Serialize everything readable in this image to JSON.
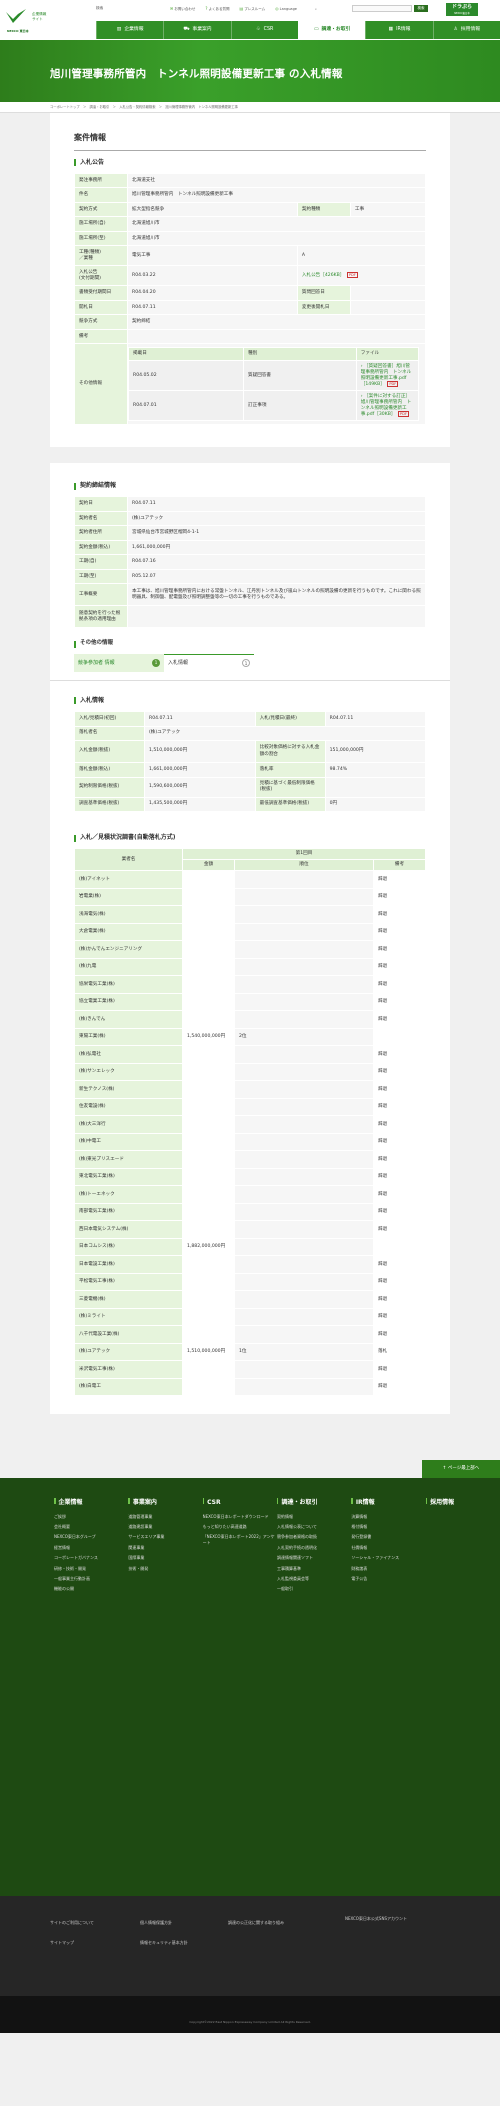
{
  "header": {
    "logo_text": "NEXCO 東日本",
    "corp_name": [
      "企業情報",
      "サイト"
    ],
    "search_label": "検索",
    "util": [
      "お問い合わせ",
      "よくある質問",
      "プレスルーム",
      "Language"
    ],
    "search_btn": "検索",
    "doraburu": "ドラぷら",
    "doraburu_sub": "NEXCO東日本"
  },
  "nav": [
    "企業情報",
    "事業案内",
    "CSR",
    "調達・お取引",
    "IR情報",
    "採用情報"
  ],
  "page": {
    "title": "旭川管理事務所管内　トンネル照明設備更新工事 の入札情報",
    "breadcrumb": "コーポレートトップ　＞　調達・お取引　＞　入札公告・契約情報検索　＞　旭川管理事務所管内　トンネル照明設備更新工事"
  },
  "case": {
    "title": "案件情報",
    "sub": "入札公告",
    "rows": [
      {
        "k": "発注事務所",
        "v": "北海道支社"
      },
      {
        "k": "件名",
        "v": "旭川管理事務所管内　トンネル照明設備更新工事"
      },
      {
        "k": "契約方式",
        "v": "拡大型指名競争",
        "k2": "契約種類",
        "v2": "工事"
      },
      {
        "k": "施工場所(自)",
        "v": "北海道旭川市"
      },
      {
        "k": "施工場所(至)",
        "v": "北海道旭川市"
      },
      {
        "k": "工種(種類)\n／業種",
        "v": "電気工事",
        "v2": "A"
      },
      {
        "k": "入札公告\n(文付期間)",
        "v": "R04.03.22",
        "v2": "入札公告［426KB］"
      },
      {
        "k": "書類受付期間日",
        "v": "R04.04.20",
        "k2": "質問回答日",
        "v2": ""
      },
      {
        "k": "開札日",
        "v": "R04.07.11",
        "k2": "変更後開札日",
        "v2": ""
      },
      {
        "k": "競争方式",
        "v": "契約締結"
      },
      {
        "k": "備考",
        "v": ""
      }
    ],
    "other_label": "その他情報",
    "other_head": [
      "掲載日",
      "種別",
      "ファイル"
    ],
    "other_rows": [
      {
        "date": "R04.05.02",
        "type": "質疑回答書",
        "file": "［質疑回答書］旭川管理事務所管内　トンネル照明設備更新工事.pdf［149KB］"
      },
      {
        "date": "R04.07.01",
        "type": "訂正事項",
        "file": "［案件に対する訂正］旭川管理事務所管内　トンネル照明設備更新工事.pdf［30KB］"
      }
    ]
  },
  "contract": {
    "sub": "契約締結情報",
    "rows": [
      {
        "k": "契約日",
        "v": "R04.07.11"
      },
      {
        "k": "契約者名",
        "v": "(株)ユアテック"
      },
      {
        "k": "契約者住所",
        "v": "宮城県仙台市宮城野区榴岡4-1-1"
      },
      {
        "k": "契約金額(税込)",
        "v": "1,661,000,000円"
      },
      {
        "k": "工期(自)",
        "v": "R04.07.16"
      },
      {
        "k": "工期(至)",
        "v": "R05.12.07"
      },
      {
        "k": "工事概要",
        "v": "本工事は、旭川管理事務所管内における常盤トンネル、江丹別トンネル及び嵐山トンネルの照明設備の更新を行うものです。これに関わる照明器具、制御盤、配電盤及び照明調整盤等の一切の工事を行うものである。"
      },
      {
        "k": "随意契約を行った根拠条項の適用理由",
        "v": ""
      }
    ]
  },
  "other_info": {
    "title": "その他の情報",
    "tabs": [
      {
        "label": "競争参加者 情報",
        "count": "1"
      },
      {
        "label": "入札情報",
        "count": "1"
      }
    ]
  },
  "bid": {
    "sub": "入札情報",
    "rows": [
      {
        "k": "入札/見積日(初回)",
        "v": "R04.07.11",
        "k2": "入札/見積日(最終)",
        "v2": "R04.07.11"
      },
      {
        "k": "落札者名",
        "v": "(株)ユアテック"
      },
      {
        "k": "入札金額(税抜)",
        "v": "1,510,000,000円",
        "k2": "比較対象価格に対する入札金額の割合",
        "v2": "151,000,000円"
      },
      {
        "k": "落札金額(税込)",
        "v": "1,661,000,000円",
        "k2": "落札率",
        "v2": "98.74%"
      },
      {
        "k": "契約制限価格(税抜)",
        "v": "1,590,600,000円",
        "k2": "見積に基づく最低制限価格(税抜)",
        "v2": ""
      },
      {
        "k": "調査基準価格(税抜)",
        "v": "1,435,500,000円",
        "k2": "最低調査基準価格(税抜)",
        "v2": "0円"
      }
    ]
  },
  "status": {
    "sub": "入札／見積状況調書(自動落札方式)",
    "head": [
      "業者名",
      "第1回目",
      "金額",
      "順位",
      "備考"
    ],
    "rows": [
      [
        "(株)アイネット",
        "",
        "",
        "辞退"
      ],
      [
        "岩電業(株)",
        "",
        "",
        "辞退"
      ],
      [
        "浅海電気(株)",
        "",
        "",
        "辞退"
      ],
      [
        "大倉電業(株)",
        "",
        "",
        "辞退"
      ],
      [
        "(株)かんでんエンジニアリング",
        "",
        "",
        "辞退"
      ],
      [
        "(株)九電",
        "",
        "",
        "辞退"
      ],
      [
        "協栄電気工業(株)",
        "",
        "",
        "辞退"
      ],
      [
        "協立電業工業(株)",
        "",
        "",
        "辞退"
      ],
      [
        "(株)きんでん",
        "",
        "",
        "辞退"
      ],
      [
        "東陽工業(株)",
        "1,540,000,000円",
        "2位",
        ""
      ],
      [
        "(株)弘電社",
        "",
        "",
        "辞退"
      ],
      [
        "(株)サンエレック",
        "",
        "",
        "辞退"
      ],
      [
        "新生テクノス(株)",
        "",
        "",
        "辞退"
      ],
      [
        "住友電設(株)",
        "",
        "",
        "辞退"
      ],
      [
        "(株)大三洋行",
        "",
        "",
        "辞退"
      ],
      [
        "(株)中電工",
        "",
        "",
        "辞退"
      ],
      [
        "(株)東光プリスエード",
        "",
        "",
        "辞退"
      ],
      [
        "東北電気工業(株)",
        "",
        "",
        "辞退"
      ],
      [
        "(株)トーエネック",
        "",
        "",
        "辞退"
      ],
      [
        "南部電気工業(株)",
        "",
        "",
        "辞退"
      ],
      [
        "西日本電気システム(株)",
        "",
        "",
        "辞退"
      ],
      [
        "日本コムシス(株)",
        "1,882,000,000円",
        "",
        ""
      ],
      [
        "日本電設工業(株)",
        "",
        "",
        "辞退"
      ],
      [
        "平松電気工事(株)",
        "",
        "",
        "辞退"
      ],
      [
        "三菱電機(株)",
        "",
        "",
        "辞退"
      ],
      [
        "(株)ミライト",
        "",
        "",
        "辞退"
      ],
      [
        "八千代電設工業(株)",
        "",
        "",
        "辞退"
      ],
      [
        "(株)ユアテック",
        "1,510,000,000円",
        "1位",
        "落札"
      ],
      [
        "米沢電気工事(株)",
        "",
        "",
        "辞退"
      ],
      [
        "(株)白電工",
        "",
        "",
        "辞退"
      ]
    ]
  },
  "footer": {
    "to_top": "ページ最上部へ",
    "cols": [
      {
        "h": "企業情報",
        "items": [
          "ご挨拶",
          "会社概要",
          "NEXCO東日本グループ",
          "経営情報",
          "コーポレートガバナンス",
          "研修・技術・開発",
          "一般事業主行動計画",
          "機能の公開"
        ]
      },
      {
        "h": "事業案内",
        "items": [
          "道路管理事業",
          "道路建設事業",
          "サービスエリア事業",
          "関連事業",
          "国際事業",
          "技術・開発"
        ]
      },
      {
        "h": "CSR",
        "items": [
          "NEXCO東日本レポートダウンロード",
          "もっと知りたい高速道路",
          "「NEXCO東日本レポート2022」アンケート"
        ]
      },
      {
        "h": "調達・お取引",
        "items": [
          "契約情報",
          "入札情報公表について",
          "競争参加者資格の取扱",
          "入札契約手続の透明化",
          "調達情報関連ソフト",
          "工事積算基準",
          "入札監視委員会等",
          "一般取引"
        ]
      },
      {
        "h": "IR情報",
        "items": [
          "決算情報",
          "格付情報",
          "発行登録書",
          "社債情報",
          "ソーシャル・ファイナンス",
          "財務諸表",
          "電子公告"
        ]
      },
      {
        "h": "採用情報",
        "items": []
      }
    ]
  },
  "bottom": {
    "links": [
      "サイトのご利用について",
      "個人情報保護方針",
      "サイトマップ",
      "情報セキュリティ基本方針",
      "調達の公正化に関する取り組み",
      "NEXCO東日本公式SNSアカウント"
    ],
    "copyright": "Copyright©2022 East Nippon Expressway Company Limited All Rights Reserved."
  }
}
